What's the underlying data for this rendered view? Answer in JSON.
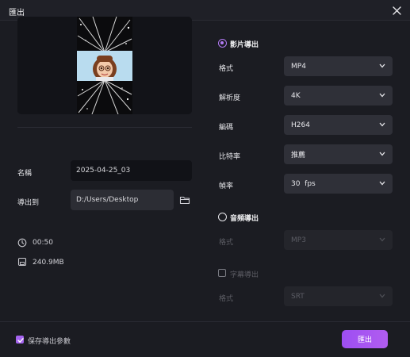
{
  "window": {
    "title": "匯出"
  },
  "left": {
    "name_label": "名稱",
    "name_value": "2025-04-25_03",
    "export_to_label": "導出到",
    "export_path": "D:/Users/Desktop",
    "duration": "00:50",
    "file_size": "240.9MB"
  },
  "video_export": {
    "label": "影片導出",
    "selected": true,
    "rows": [
      {
        "label": "格式",
        "value": "MP4"
      },
      {
        "label": "解析度",
        "value": "4K"
      },
      {
        "label": "編碼",
        "value": "H264"
      },
      {
        "label": "比特率",
        "value": "推薦"
      },
      {
        "label": "幀率",
        "value": "30  fps"
      }
    ]
  },
  "audio_export": {
    "label": "音頻導出",
    "selected": false,
    "format_label": "格式",
    "format_value": "MP3"
  },
  "subtitle_export": {
    "label": "字幕導出",
    "checked": false,
    "format_label": "格式",
    "format_value": "SRT"
  },
  "footer": {
    "save_params_label": "保存導出參數",
    "save_params_checked": true,
    "export_button": "匯出"
  },
  "colors": {
    "accent": "#a564ef",
    "background": "#1b1c22",
    "input_bg": "#2f3038"
  },
  "icons": [
    "close-icon",
    "folder-icon",
    "clock-icon",
    "file-size-icon",
    "chevron-down-icon",
    "check-icon"
  ]
}
